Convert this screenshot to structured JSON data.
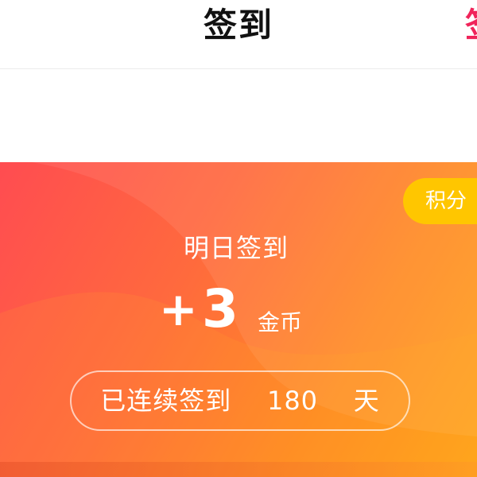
{
  "header": {
    "title": "签到",
    "right_cut_char": "签"
  },
  "card": {
    "badge_label": "积分",
    "tomorrow_label": "明日签到",
    "reward": {
      "sign": "+",
      "value": "3",
      "unit": "金币"
    },
    "streak": {
      "prefix": "已连续签到",
      "days": "180",
      "suffix": "天"
    }
  },
  "colors": {
    "header_bg": "#ffffff",
    "title_text": "#111111",
    "accent_red": "#f0245a",
    "card_gradient_start": "#ff4c51",
    "card_gradient_end": "#ffa41a",
    "badge_bg": "#ffc600",
    "card_text": "#ffffff"
  }
}
